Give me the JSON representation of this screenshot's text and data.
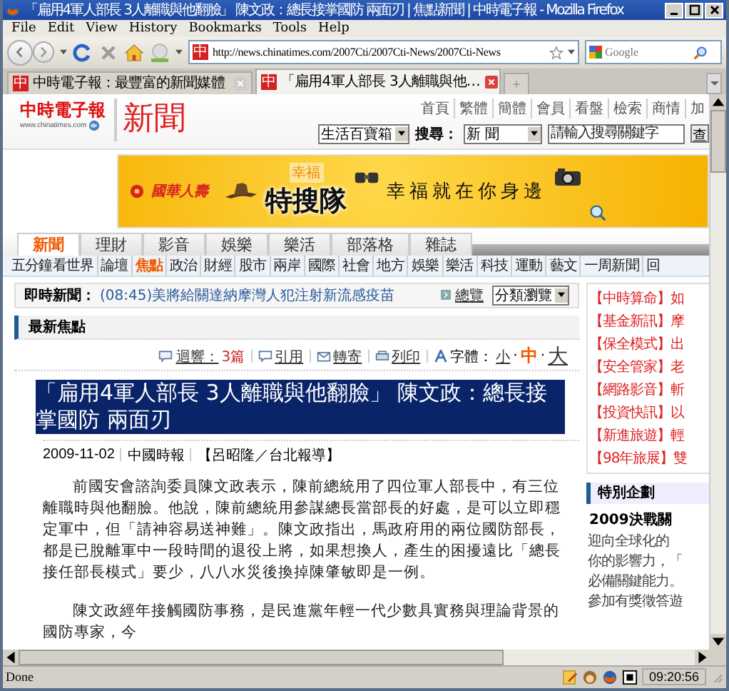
{
  "window": {
    "title": "「扁用4軍人部長 3人離職與他翻臉」 陳文政：總長接掌國防 兩面刃 | 焦點新聞 | 中時電子報 - Mozilla Firefox"
  },
  "menu": [
    "File",
    "Edit",
    "View",
    "History",
    "Bookmarks",
    "Tools",
    "Help"
  ],
  "address_bar": {
    "icon_text": "中",
    "value": "http://news.chinatimes.com/2007Cti/2007Cti-News/2007Cti-News"
  },
  "search_bar": {
    "placeholder": "Google"
  },
  "tabs": [
    {
      "icon_text": "中",
      "label": "中時電子報：最豐富的新聞媒體",
      "selected": false
    },
    {
      "icon_text": "中",
      "label": "「扁用4軍人部長 3人離職與他…",
      "selected": true
    }
  ],
  "site_header": {
    "logo": "中時電子報",
    "logo_url": "www.chinatimes.com",
    "section": "新聞",
    "top_links": [
      "首頁",
      "繁體",
      "簡體",
      "會員",
      "看盤",
      "檢索",
      "商情",
      "加"
    ],
    "category_select": "生活百寶箱",
    "search_label": "搜尋：",
    "search_scope": "新 聞",
    "search_placeholder": "請輸入搜尋關鍵字",
    "search_button": "查"
  },
  "banner": {
    "brand": "國華人壽",
    "tag": "幸福",
    "title": "特搜隊",
    "slogan": "幸福就在你身邊"
  },
  "main_tabs": [
    {
      "label": "新聞",
      "selected": true
    },
    {
      "label": "理財",
      "selected": false
    },
    {
      "label": "影音",
      "selected": false
    },
    {
      "label": "娛樂",
      "selected": false
    },
    {
      "label": "樂活",
      "selected": false
    },
    {
      "label": "部落格",
      "selected": false
    },
    {
      "label": "雜誌",
      "selected": false
    }
  ],
  "sub_nav": [
    {
      "label": "五分鐘看世界",
      "selected": false
    },
    {
      "label": "論壇",
      "selected": false
    },
    {
      "label": "焦點",
      "selected": true
    },
    {
      "label": "政治",
      "selected": false
    },
    {
      "label": "財經",
      "selected": false
    },
    {
      "label": "股市",
      "selected": false
    },
    {
      "label": "兩岸",
      "selected": false
    },
    {
      "label": "國際",
      "selected": false
    },
    {
      "label": "社會",
      "selected": false
    },
    {
      "label": "地方",
      "selected": false
    },
    {
      "label": "娛樂",
      "selected": false
    },
    {
      "label": "樂活",
      "selected": false
    },
    {
      "label": "科技",
      "selected": false
    },
    {
      "label": "運動",
      "selected": false
    },
    {
      "label": "藝文",
      "selected": false
    },
    {
      "label": "一周新聞",
      "selected": false
    },
    {
      "label": "回",
      "selected": false
    }
  ],
  "breaking": {
    "label": "即時新聞：",
    "headline": "(08:45)美將給關達納摩灣人犯注射新流感疫苗",
    "overview": "總覽",
    "browse_select": "分類瀏覽"
  },
  "section_title": "最新焦點",
  "tools": {
    "comments_label": "迴響：",
    "comments_count": "3篇",
    "cite": "引用",
    "forward": "轉寄",
    "print": "列印",
    "font_label": "字體：",
    "separators": [
      "·",
      "·"
    ],
    "sizes": [
      {
        "label": "小",
        "selected": false
      },
      {
        "label": "中",
        "selected": true
      },
      {
        "label": "大",
        "selected": false
      }
    ]
  },
  "article": {
    "headline": "「扁用4軍人部長 3人離職與他翻臉」 陳文政：總長接掌國防 兩面刃",
    "date": "2009-11-02",
    "source": "中國時報",
    "byline": "【呂昭隆／台北報導】",
    "paragraphs": [
      "前國安會諮詢委員陳文政表示，陳前總統用了四位軍人部長中，有三位離職時與他翻臉。他說，陳前總統用參謀總長當部長的好處，是可以立即穩定軍中，但「請神容易送神難」。陳文政指出，馬政府用的兩位國防部長，都是已脫離軍中一段時間的退役上將，如果想換人，產生的困擾遠比「總長接任部長模式」要少，八八水災後換掉陳肇敏即是一例。",
      "陳文政經年接觸國防事務，是民進黨年輕一代少數具實務與理論背景的國防專家，今"
    ]
  },
  "sidebar": {
    "links": [
      "【中時算命】如",
      "【基金新訊】摩",
      "【保全模式】出",
      "【安全管家】老",
      "【網路影音】斬",
      "【投資快訊】以",
      "【新進旅遊】輕",
      "【98年旅展】雙"
    ],
    "feature_title": "特別企劃",
    "feature_headline": "2009決戰關",
    "feature_lines": [
      "迎向全球化的",
      "你的影響力，「",
      "必備關鍵能力。",
      "參加有獎徵答遊"
    ]
  },
  "status_bar": {
    "text": "Done",
    "time": "09:20:56"
  }
}
